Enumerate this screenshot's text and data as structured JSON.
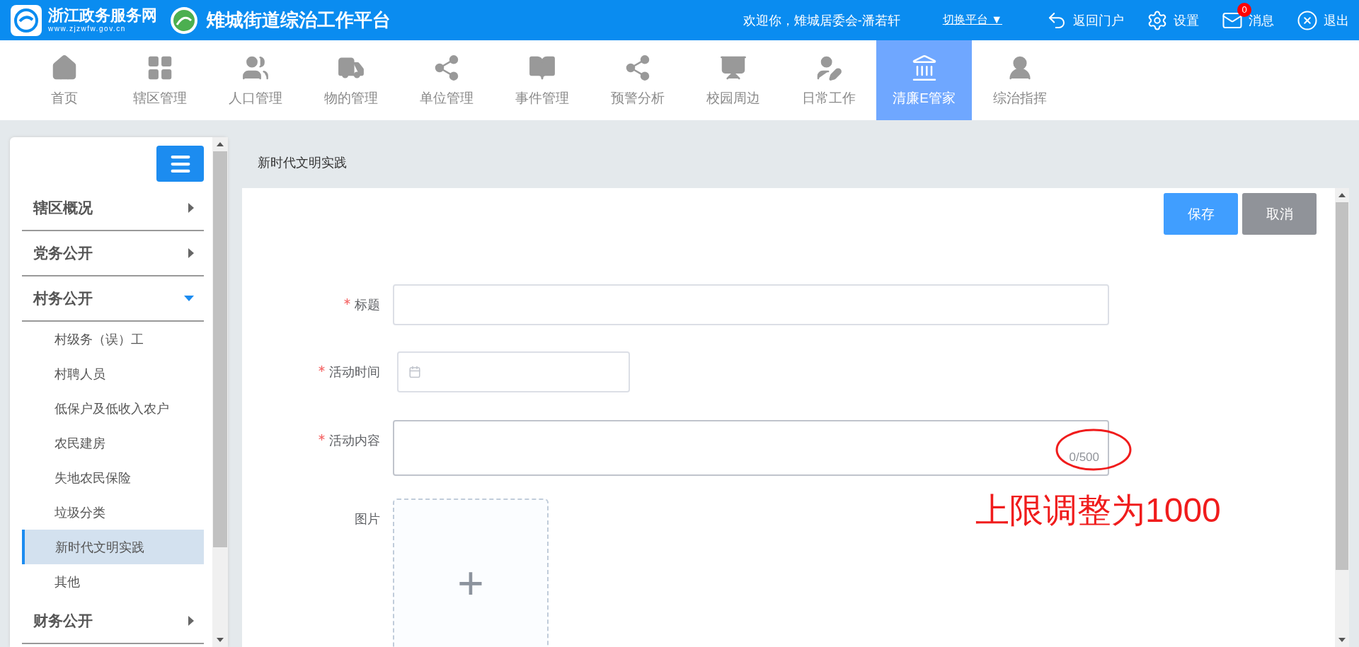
{
  "header": {
    "portal_name": "浙江政务服务网",
    "portal_url": "www.zjzwfw.gov.cn",
    "platform_title": "雉城街道综治工作平台",
    "welcome": "欢迎你，雉城居委会-潘若轩",
    "switch": "切换平台 ▼",
    "actions": [
      {
        "label": "返回门户"
      },
      {
        "label": "设置"
      },
      {
        "label": "消息",
        "badge": "0"
      },
      {
        "label": "退出"
      }
    ]
  },
  "nav": [
    {
      "label": "首页",
      "selected": false
    },
    {
      "label": "辖区管理",
      "selected": false
    },
    {
      "label": "人口管理",
      "selected": false
    },
    {
      "label": "物的管理",
      "selected": false
    },
    {
      "label": "单位管理",
      "selected": false
    },
    {
      "label": "事件管理",
      "selected": false
    },
    {
      "label": "预警分析",
      "selected": false
    },
    {
      "label": "校园周边",
      "selected": false
    },
    {
      "label": "日常工作",
      "selected": false
    },
    {
      "label": "清廉E管家",
      "selected": true
    },
    {
      "label": "综治指挥",
      "selected": false
    }
  ],
  "sidebar": {
    "sections": [
      {
        "label": "辖区概况",
        "expanded": false
      },
      {
        "label": "党务公开",
        "expanded": false
      },
      {
        "label": "村务公开",
        "expanded": true,
        "children": [
          {
            "label": "村级务（误）工",
            "selected": false
          },
          {
            "label": "村聘人员",
            "selected": false
          },
          {
            "label": "低保户及低收入农户",
            "selected": false
          },
          {
            "label": "农民建房",
            "selected": false
          },
          {
            "label": "失地农民保险",
            "selected": false
          },
          {
            "label": "垃圾分类",
            "selected": false
          },
          {
            "label": "新时代文明实践",
            "selected": true
          },
          {
            "label": "其他",
            "selected": false
          }
        ]
      },
      {
        "label": "财务公开",
        "expanded": false
      }
    ]
  },
  "breadcrumb": "新时代文明实践",
  "buttons": [
    {
      "label": "保存",
      "kind": "primary"
    },
    {
      "label": "取消",
      "kind": "secondary"
    }
  ],
  "form": [
    {
      "kind": "text",
      "label": "标题",
      "required": true
    },
    {
      "kind": "date",
      "label": "活动时间",
      "required": true
    },
    {
      "kind": "textarea",
      "label": "活动内容",
      "required": true,
      "counter": "0/500"
    },
    {
      "kind": "upload",
      "label": "图片",
      "required": false,
      "button": "+"
    }
  ],
  "annotation": "上限调整为1000"
}
